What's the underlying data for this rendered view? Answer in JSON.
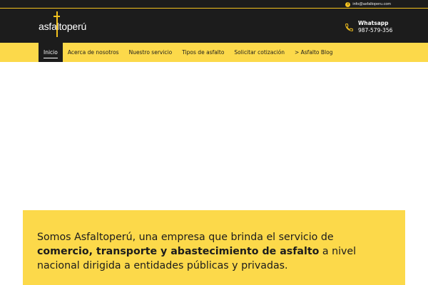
{
  "topbar": {
    "email": "info@asfaltoperu.com"
  },
  "header": {
    "logo_text": "asfaltoperú",
    "contact_label": "Whatsapp",
    "contact_number": "987-579-356"
  },
  "nav": {
    "items": [
      {
        "label": "Inicio"
      },
      {
        "label": "Acerca de nosotros"
      },
      {
        "label": "Nuestro servicio"
      },
      {
        "label": "Tipos de asfalto"
      },
      {
        "label": "Solicitar cotización"
      },
      {
        "label": "> Asfalto Blog"
      }
    ],
    "active_index": 0
  },
  "intro": {
    "part1": "Somos Asfaltoperú, una empresa que brinda el servicio de ",
    "bold": "comercio, transporte y abastecimiento de asfalto",
    "part2": " a nivel nacional dirigida a entidades públicas y privadas."
  },
  "colors": {
    "brand_yellow": "#fcd94a",
    "accent_yellow": "#f4c21e",
    "dark": "#1c1c1c"
  },
  "icons": [
    "info-icon",
    "phone-icon"
  ]
}
